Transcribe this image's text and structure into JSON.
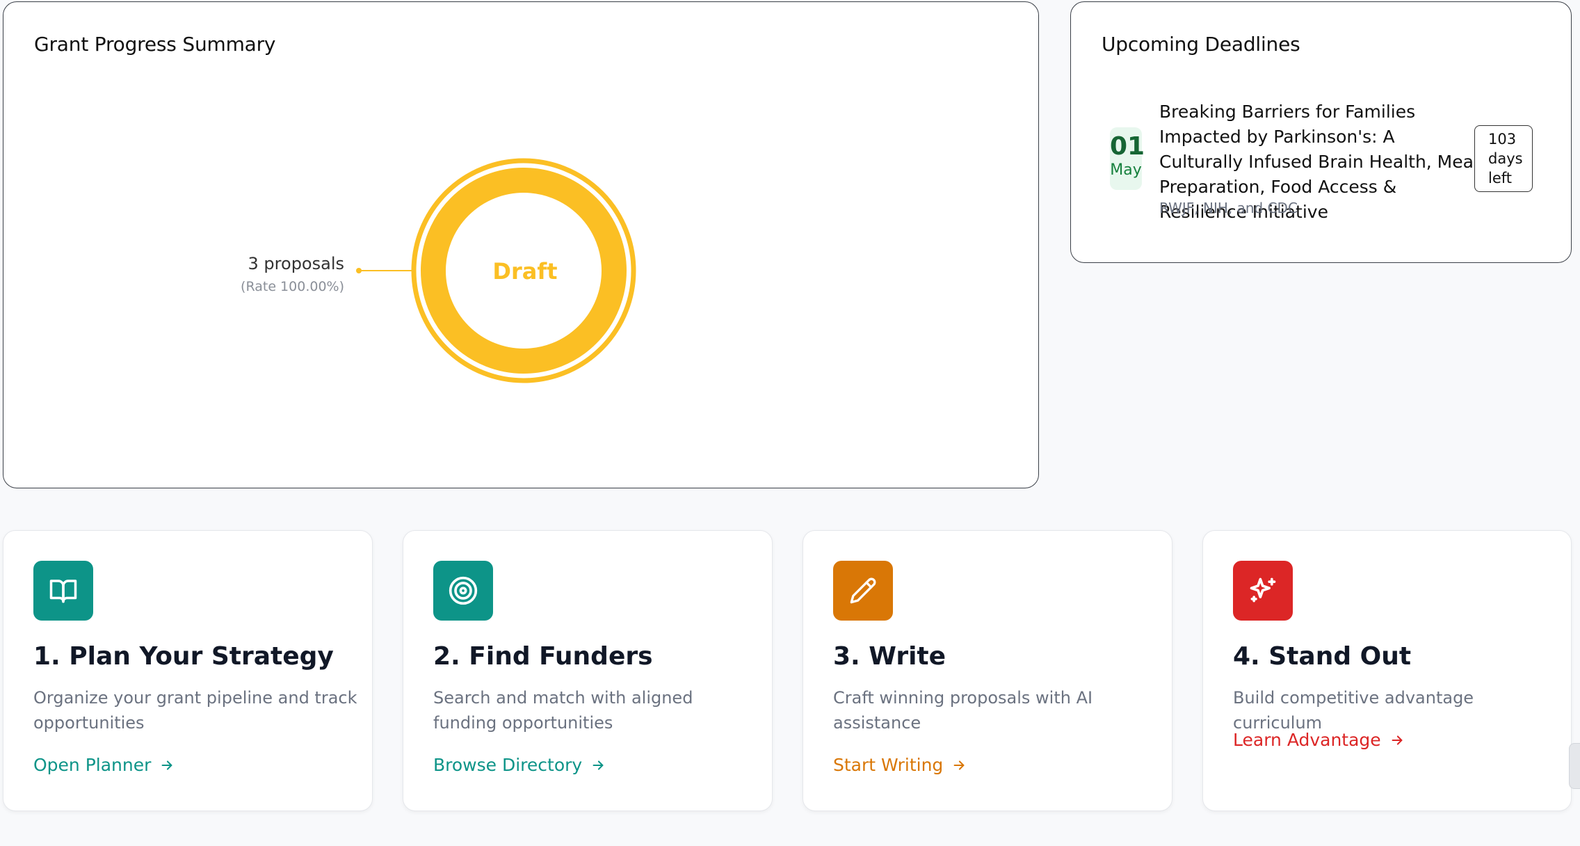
{
  "progress": {
    "title": "Grant Progress Summary",
    "status_label": "Draft",
    "count_label": "3 proposals",
    "rate_label": "(Rate 100.00%)",
    "chart_data": {
      "type": "pie",
      "categories": [
        "Draft"
      ],
      "values": [
        3
      ],
      "rates": [
        100.0
      ]
    }
  },
  "deadlines": {
    "title": "Upcoming Deadlines",
    "items": [
      {
        "day": "01",
        "month": "May",
        "title": "Breaking Barriers for Families Impacted by Parkinson's: A Culturally Infused Brain Health, Meal Preparation, Food Access & Resilience Initiative",
        "funder": "RWJF, NIH, and CDC",
        "days_number": "103",
        "days_word": "days",
        "days_suffix": "left"
      }
    ]
  },
  "cards": [
    {
      "title": "1. Plan Your Strategy",
      "description": "Organize your grant pipeline and track opportunities",
      "link": "Open Planner",
      "color": "#0d9488",
      "icon": "book-open-icon"
    },
    {
      "title": "2. Find Funders",
      "description": "Search and match with aligned funding opportunities",
      "link": "Browse Directory",
      "color": "#0d9488",
      "icon": "target-icon"
    },
    {
      "title": "3. Write",
      "description": "Craft winning proposals with AI assistance",
      "link": "Start Writing",
      "color": "#d97706",
      "icon": "pencil-icon"
    },
    {
      "title": "4. Stand Out",
      "description": "Build competitive advantage curriculum",
      "link": "Learn Advantage",
      "color": "#dc2626",
      "icon": "sparkles-icon"
    }
  ],
  "colors": {
    "draft": "#fbbf24",
    "teal": "#0d9488",
    "amber": "#d97706",
    "red": "#dc2626",
    "date_green": "#166534"
  }
}
